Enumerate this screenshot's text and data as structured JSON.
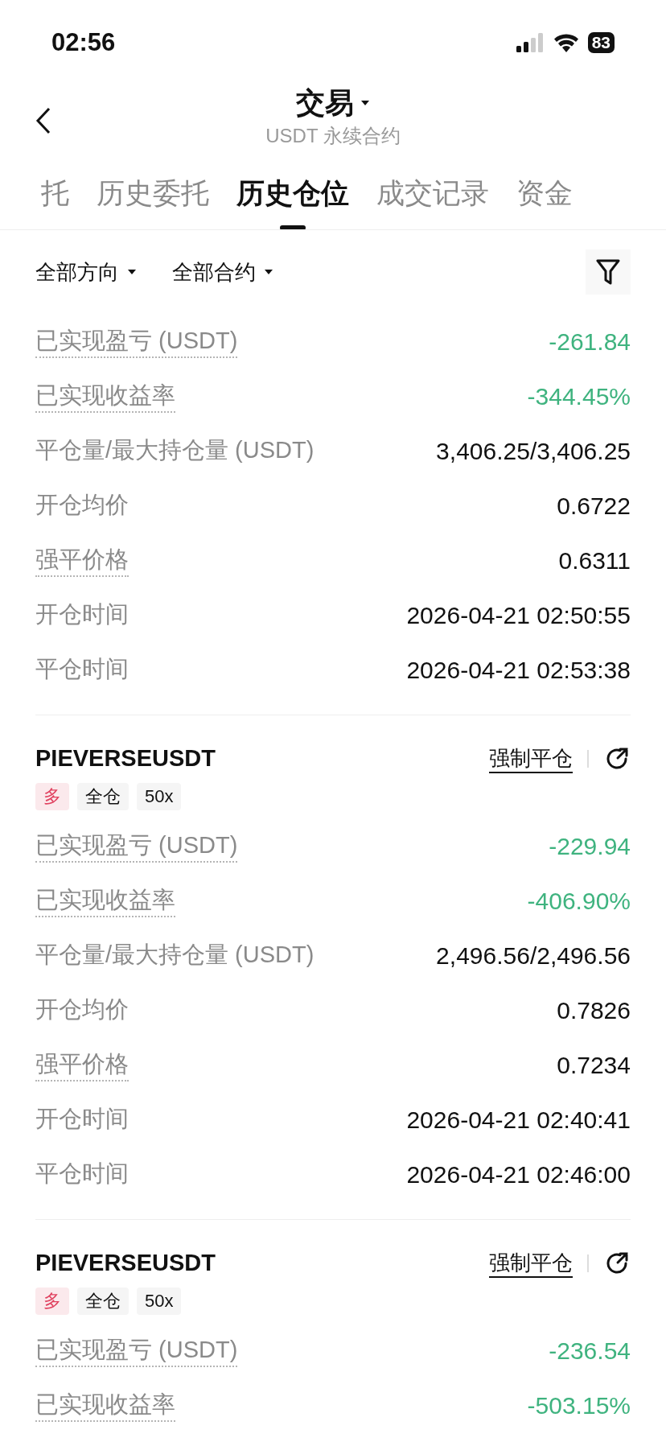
{
  "status_bar": {
    "time": "02:56",
    "battery": "83"
  },
  "header": {
    "title": "交易",
    "subtitle": "USDT 永续合约"
  },
  "tabs": [
    {
      "label": "托",
      "selected": false
    },
    {
      "label": "历史委托",
      "selected": false
    },
    {
      "label": "历史仓位",
      "selected": true
    },
    {
      "label": "成交记录",
      "selected": false
    },
    {
      "label": "资金",
      "selected": false
    }
  ],
  "filters": [
    "全部方向",
    "全部合约"
  ],
  "positions": [
    {
      "rows": [
        {
          "label": "已实现盈亏 (USDT)",
          "value": "-261.84",
          "dotted": true,
          "kind": "loss"
        },
        {
          "label": "已实现收益率",
          "value": "-344.45%",
          "dotted": true,
          "kind": "loss"
        },
        {
          "label": "平仓量/最大持仓量 (USDT)",
          "value": "3,406.25/3,406.25",
          "dotted": false,
          "kind": "plain"
        },
        {
          "label": "开仓均价",
          "value": "0.6722",
          "dotted": false,
          "kind": "plain"
        },
        {
          "label": "强平价格",
          "value": "0.6311",
          "dotted": true,
          "kind": "plain"
        },
        {
          "label": "开仓时间",
          "value": "2026-04-21 02:50:55",
          "dotted": false,
          "kind": "plain"
        },
        {
          "label": "平仓时间",
          "value": "2026-04-21 02:53:38",
          "dotted": false,
          "kind": "plain"
        }
      ]
    },
    {
      "symbol": "PIEVERSEUSDT",
      "action": "强制平仓",
      "tags": [
        {
          "label": "多",
          "kind": "side"
        },
        {
          "label": "全仓",
          "kind": "plain"
        },
        {
          "label": "50x",
          "kind": "plain"
        }
      ],
      "rows": [
        {
          "label": "已实现盈亏 (USDT)",
          "value": "-229.94",
          "dotted": true,
          "kind": "loss"
        },
        {
          "label": "已实现收益率",
          "value": "-406.90%",
          "dotted": true,
          "kind": "loss"
        },
        {
          "label": "平仓量/最大持仓量 (USDT)",
          "value": "2,496.56/2,496.56",
          "dotted": false,
          "kind": "plain"
        },
        {
          "label": "开仓均价",
          "value": "0.7826",
          "dotted": false,
          "kind": "plain"
        },
        {
          "label": "强平价格",
          "value": "0.7234",
          "dotted": true,
          "kind": "plain"
        },
        {
          "label": "开仓时间",
          "value": "2026-04-21 02:40:41",
          "dotted": false,
          "kind": "plain"
        },
        {
          "label": "平仓时间",
          "value": "2026-04-21 02:46:00",
          "dotted": false,
          "kind": "plain"
        }
      ]
    },
    {
      "symbol": "PIEVERSEUSDT",
      "action": "强制平仓",
      "tags": [
        {
          "label": "多",
          "kind": "side"
        },
        {
          "label": "全仓",
          "kind": "plain"
        },
        {
          "label": "50x",
          "kind": "plain"
        }
      ],
      "rows": [
        {
          "label": "已实现盈亏 (USDT)",
          "value": "-236.54",
          "dotted": true,
          "kind": "loss"
        },
        {
          "label": "已实现收益率",
          "value": "-503.15%",
          "dotted": true,
          "kind": "loss"
        }
      ]
    }
  ]
}
